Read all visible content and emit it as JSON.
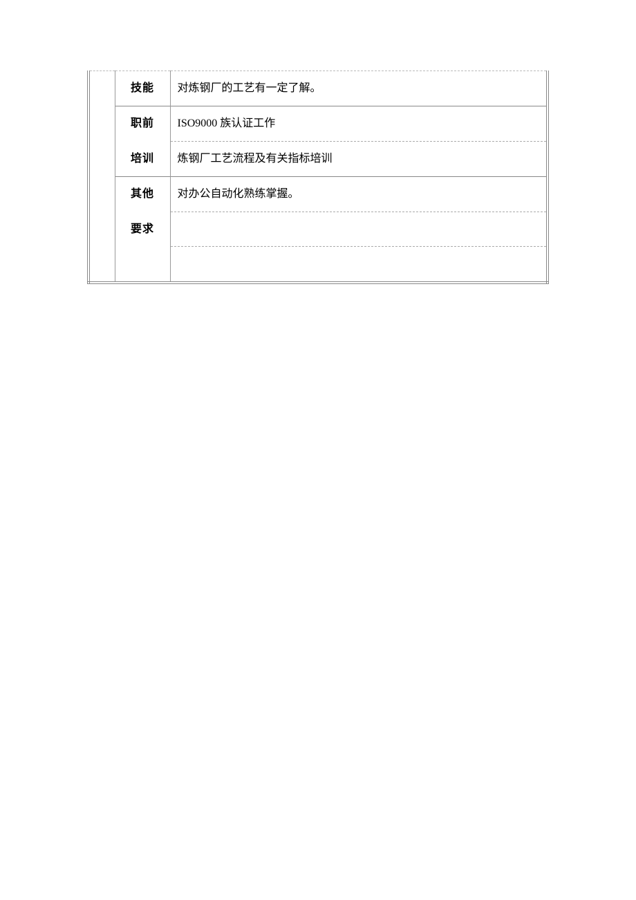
{
  "rows": {
    "skill": {
      "label": "技能",
      "content": "对炼钢厂的工艺有一定了解。"
    },
    "pretraining1": {
      "label": "职前",
      "content": "ISO9000 族认证工作"
    },
    "pretraining2": {
      "label": "培训",
      "content": "炼钢厂工艺流程及有关指标培训"
    },
    "other1": {
      "label": "其他",
      "content": "对办公自动化熟练掌握。"
    },
    "other2": {
      "label": "要求",
      "content": ""
    },
    "other3": {
      "content": ""
    }
  }
}
